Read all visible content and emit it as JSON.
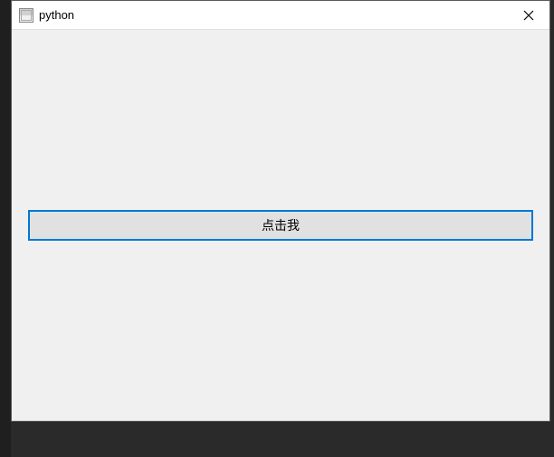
{
  "window": {
    "title": "python"
  },
  "button": {
    "label": "点击我"
  }
}
